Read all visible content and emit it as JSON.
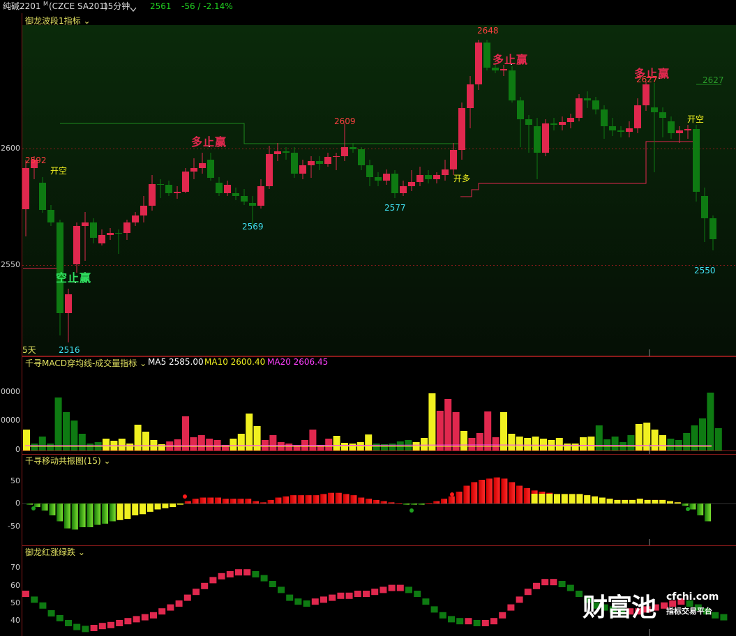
{
  "header": {
    "symbol": "纯碱2201",
    "symbol_mark": "M",
    "exchange_code": "(CZCE SA201)",
    "period": "15分钟",
    "dropdown_icon": "chevron-down-icon",
    "price": "2561",
    "change": "-56 / -2.14%"
  },
  "main_panel": {
    "title": "御龙波段1指标",
    "y_labels": [
      "2600",
      "2550"
    ],
    "five_day": "5天",
    "annotations": {
      "p2592": "2592",
      "kai_kong_1": "开空",
      "p2516": "2516",
      "kong_zhi_ying": "空止赢",
      "duo_zhi_ying_1": "多止赢",
      "p2569": "2569",
      "p2609": "2609",
      "p2577": "2577",
      "kai_duo": "开多",
      "p2648": "2648",
      "duo_zhi_ying_2": "多止赢",
      "duo_zhi_ying_3": "多止赢",
      "p2627": "2627",
      "kai_kong_2": "开空",
      "p2627_right": "2627",
      "p2550": "2550"
    }
  },
  "volume_panel": {
    "title": "千寻MACD穿均线-成交量指标",
    "ma5": "MA5 2585.00",
    "ma10": "MA10 2600.40",
    "ma20": "MA20 2606.45",
    "y_labels": [
      "0000",
      "0000",
      "0"
    ]
  },
  "osc_panel": {
    "title": "千寻移动共振图(15)",
    "y_labels": [
      "50",
      "0",
      "-50"
    ]
  },
  "trend_panel": {
    "title": "御龙红涨绿跌",
    "y_labels": [
      "70",
      "60",
      "50",
      "40"
    ]
  },
  "watermark": {
    "brand": "财富池",
    "domain": "cfchi.com",
    "tagline": "指标交易平台"
  },
  "colors": {
    "up": "#e0284e",
    "down": "#0e7a12",
    "yellow": "#f0f020",
    "red_hist": "#ff1a1a",
    "green_hist": "#3cb814",
    "cyan_label": "#40e0f0",
    "price_red": "#ff4040",
    "change_green": "#20d020"
  }
}
